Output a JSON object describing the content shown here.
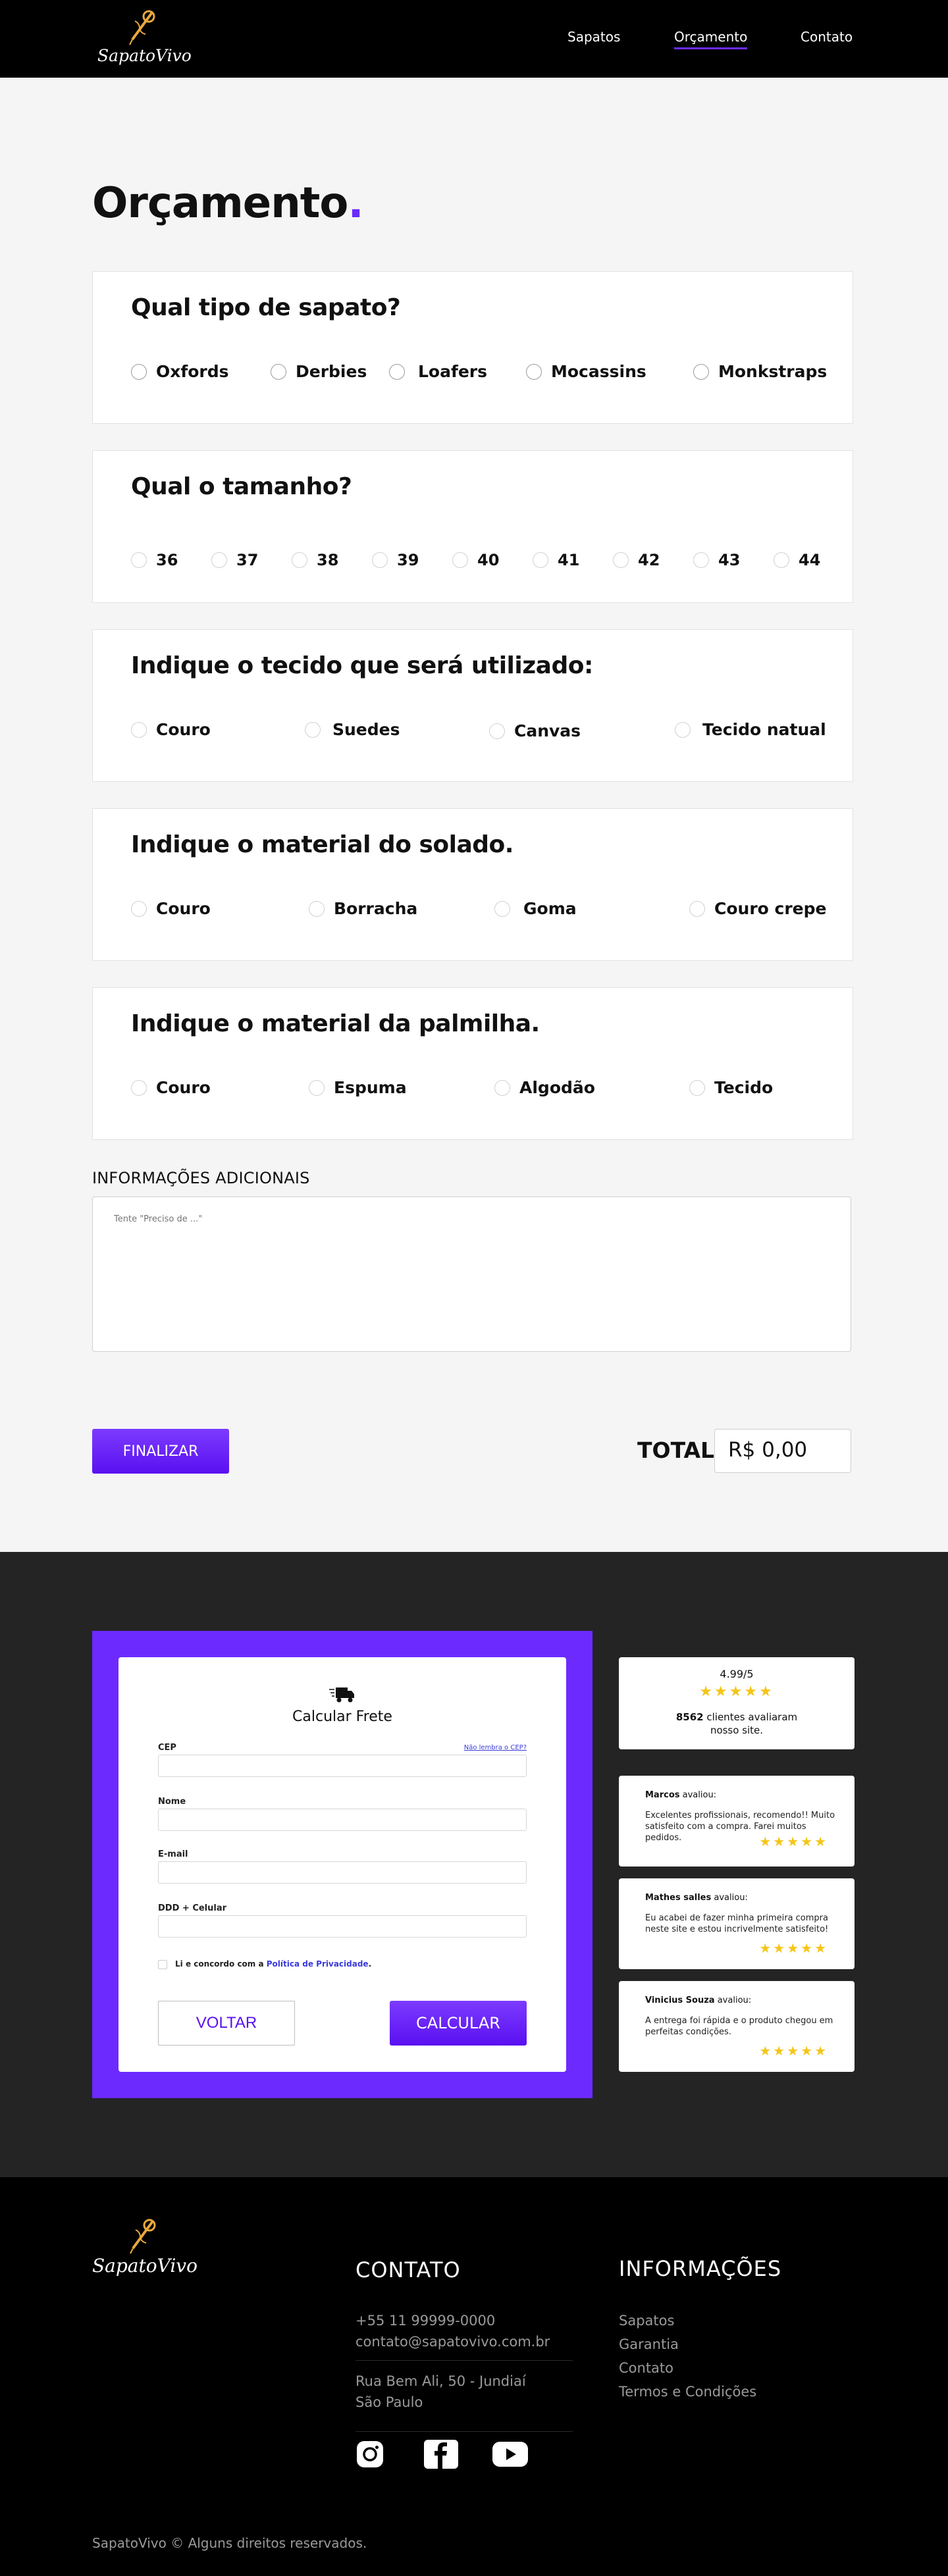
{
  "header": {
    "brand": "SapatoVivo",
    "nav": [
      {
        "label": "Sapatos"
      },
      {
        "label": "Orçamento"
      },
      {
        "label": "Contato"
      }
    ]
  },
  "main": {
    "title": "Orçamento",
    "title_dot": ".",
    "questions": [
      {
        "title": "Qual tipo de sapato?",
        "options": [
          "Oxfords",
          "Derbies",
          "Loafers",
          "Mocassins",
          "Monkstraps"
        ]
      },
      {
        "title": "Qual o tamanho?",
        "options": [
          "36",
          "37",
          "38",
          "39",
          "40",
          "41",
          "42",
          "43",
          "44"
        ]
      },
      {
        "title": "Indique o tecido que será utilizado:",
        "options": [
          "Couro",
          "Suedes",
          "Canvas",
          "Tecido natual"
        ]
      },
      {
        "title": "Indique o material do solado.",
        "options": [
          "Couro",
          "Borracha",
          "Goma",
          "Couro crepe"
        ]
      },
      {
        "title": "Indique o material da palmilha.",
        "options": [
          "Couro",
          "Espuma",
          "Algodão",
          "Tecido"
        ]
      }
    ],
    "additional_info": {
      "label": "INFORMAÇÕES ADICIONAIS",
      "placeholder": "Tente \"Preciso de ...\""
    },
    "finalize_label": "FINALIZAR",
    "total_label": "TOTAL",
    "total_value": "R$ 0,00"
  },
  "freight": {
    "title": "Calcular Frete",
    "fields": [
      {
        "label": "CEP"
      },
      {
        "label": "Nome"
      },
      {
        "label": "E-mail"
      },
      {
        "label": "DDD + Celular"
      }
    ],
    "cep_help": "Não lembra o CEP?",
    "agree_text": "Li e concordo com a",
    "privacy_link": "Política de Privacidade",
    "agree_end": ".",
    "back_label": "VOLTAR",
    "calc_label": "CALCULAR"
  },
  "reviews": {
    "score": "4.99/5",
    "stars": "★★★★★",
    "count": "8562",
    "count_text_1": "clientes avaliaram",
    "count_text_2": "nosso site.",
    "evaluated": "avaliou:",
    "items": [
      {
        "name": "Marcos",
        "text": "Excelentes profissionais, recomendo!! Muito satisfeito com a compra. Farei muitos pedidos."
      },
      {
        "name": "Mathes salles",
        "text": "Eu acabei de fazer minha primeira compra neste site  e estou incrivelmente satisfeito!"
      },
      {
        "name": "Vinicius Souza",
        "text": "A entrega foi rápida e o produto chegou em perfeitas condições."
      }
    ]
  },
  "footer": {
    "brand": "SapatoVivo",
    "contact_title": "CONTATO",
    "phone": "+55 11 99999-0000",
    "email": "contato@sapatovivo.com.br",
    "address_1": "Rua Bem Ali, 50 - Jundiaí",
    "address_2": "São Paulo",
    "info_title": "INFORMAÇÕES",
    "info_links": [
      "Sapatos",
      "Garantia",
      "Contato",
      "Termos e Condições"
    ],
    "social_icons": [
      "instagram-icon",
      "facebook-icon",
      "youtube-icon"
    ],
    "copyright": "SapatoVivo © Alguns direitos reservados."
  },
  "colors": {
    "accent": "#6b2bff",
    "header_bg": "#000000",
    "dark_band": "#242424",
    "star": "#f5c518"
  }
}
